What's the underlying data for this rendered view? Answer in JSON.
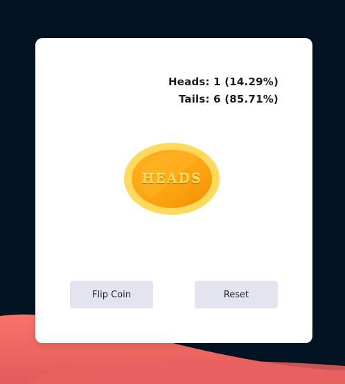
{
  "stats": {
    "heads_label": "Heads: 1 (14.29%)",
    "tails_label": "Tails: 6 (85.71%)"
  },
  "coin": {
    "face_text": "HEADS",
    "outer_color": "#ffd95a",
    "inner_color": "#fca311"
  },
  "controls": {
    "flip_label": "Flip Coin",
    "reset_label": "Reset"
  },
  "theme": {
    "background": "#021424",
    "wave_color": "#f2695f",
    "button_color": "#e4e4f1"
  }
}
